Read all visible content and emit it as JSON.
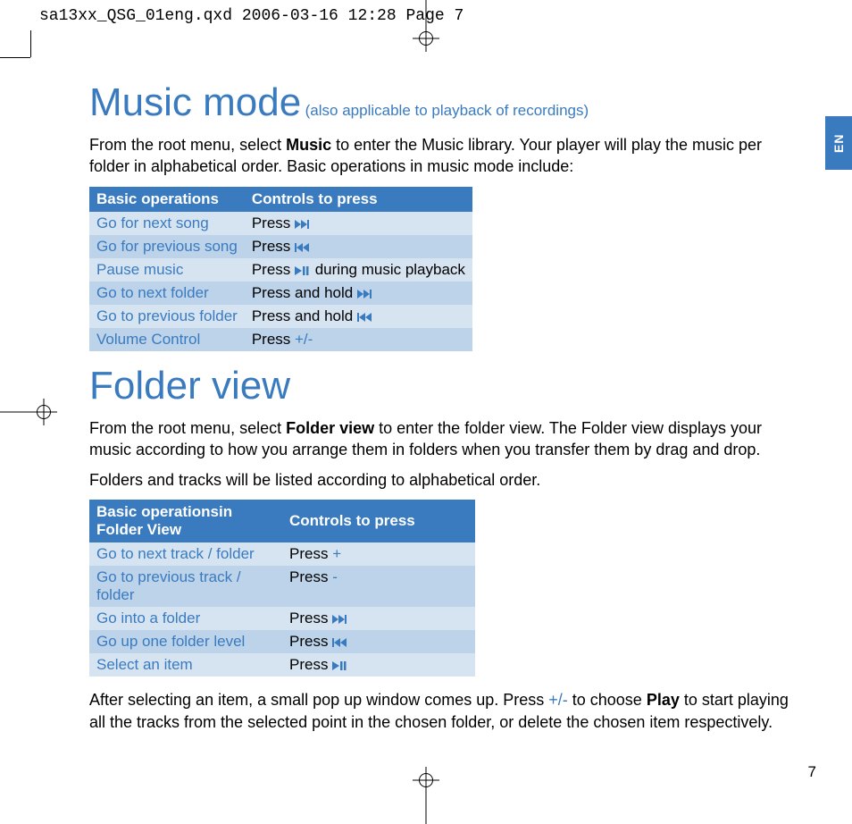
{
  "print_header": "sa13xx_QSG_01eng.qxd  2006-03-16  12:28  Page 7",
  "lang_tab": "EN",
  "page_number": "7",
  "section1": {
    "title": "Music mode",
    "subtitle": "(also applicable to playback of recordings)",
    "intro_pre": "From the root menu, select ",
    "intro_bold": "Music",
    "intro_post": " to enter the Music library. Your player will play the music per folder in alphabetical order. Basic operations in music mode include:",
    "table": {
      "head": [
        "Basic operations",
        "Controls to press"
      ],
      "rows": [
        {
          "op": "Go for next song",
          "ctrl_pre": "Press ",
          "icon": "next",
          "ctrl_post": ""
        },
        {
          "op": "Go for previous song",
          "ctrl_pre": "Press ",
          "icon": "prev",
          "ctrl_post": ""
        },
        {
          "op": "Pause music",
          "ctrl_pre": "Press ",
          "icon": "playpause",
          "ctrl_post": " during music playback"
        },
        {
          "op": "Go to next folder",
          "ctrl_pre": "Press and hold ",
          "icon": "next",
          "ctrl_post": ""
        },
        {
          "op": "Go to previous folder",
          "ctrl_pre": "Press and hold ",
          "icon": "prev",
          "ctrl_post": ""
        },
        {
          "op": "Volume Control",
          "ctrl_pre": "Press ",
          "text": "+/-",
          "ctrl_post": ""
        }
      ]
    }
  },
  "section2": {
    "title": "Folder view",
    "intro_pre": "From the root menu, select ",
    "intro_bold": "Folder view",
    "intro_post": " to enter the folder view. The Folder view displays your music according to how you arrange them in folders when you transfer them by drag and drop.",
    "para2": "Folders and tracks will be listed according to alphabetical order.",
    "table": {
      "head": [
        "Basic operationsin Folder View",
        "Controls to press"
      ],
      "rows": [
        {
          "op": "Go to next track / folder",
          "ctrl_pre": "Press ",
          "text": "+"
        },
        {
          "op": "Go to previous track / folder",
          "ctrl_pre": "Press ",
          "text": "-"
        },
        {
          "op": "Go into a folder",
          "ctrl_pre": "Press ",
          "icon": "next"
        },
        {
          "op": "Go up one folder level",
          "ctrl_pre": "Press ",
          "icon": "prev"
        },
        {
          "op": "Select an item",
          "ctrl_pre": "Press ",
          "icon": "playpause"
        }
      ]
    },
    "outro_pre": "After selecting an item, a small pop up window comes up. Press ",
    "outro_blue": "+/-",
    "outro_mid": " to choose ",
    "outro_bold": "Play",
    "outro_post": " to start playing all the tracks from the selected point in the chosen folder, or delete the chosen item respectively."
  }
}
